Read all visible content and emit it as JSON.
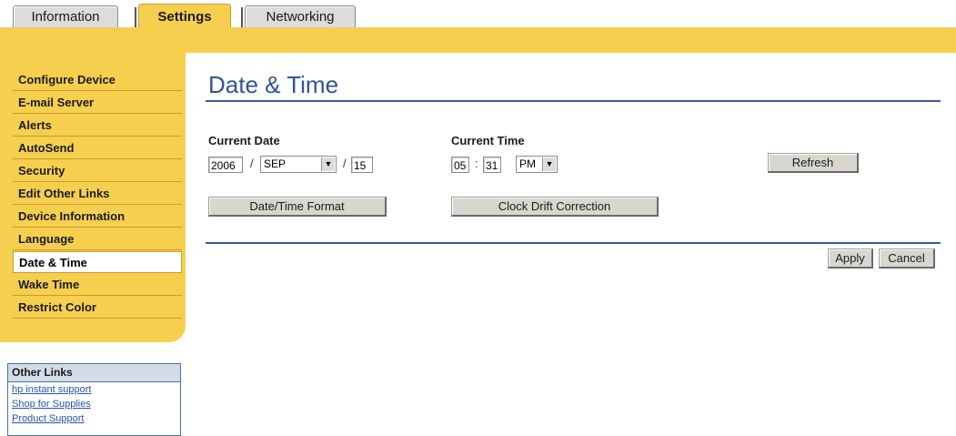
{
  "tabs": [
    {
      "label": "Information"
    },
    {
      "label": "Settings"
    },
    {
      "label": "Networking"
    }
  ],
  "sidebar": {
    "items": [
      {
        "label": "Configure Device"
      },
      {
        "label": "E-mail Server"
      },
      {
        "label": "Alerts"
      },
      {
        "label": "AutoSend"
      },
      {
        "label": "Security"
      },
      {
        "label": "Edit Other Links"
      },
      {
        "label": "Device Information"
      },
      {
        "label": "Language"
      },
      {
        "label": "Date & Time"
      },
      {
        "label": "Wake Time"
      },
      {
        "label": "Restrict Color"
      }
    ],
    "active": "Date & Time"
  },
  "other_links": {
    "title": "Other Links",
    "links": [
      {
        "label": "hp instant support"
      },
      {
        "label": "Shop for Supplies"
      },
      {
        "label": "Product Support"
      }
    ]
  },
  "main": {
    "title": "Date & Time",
    "current_date": {
      "label": "Current Date",
      "year": "2006",
      "month": "SEP",
      "day": "15",
      "sep": "/"
    },
    "current_time": {
      "label": "Current Time",
      "hour": "05",
      "minute": "31",
      "ampm": "PM",
      "sep": ":"
    },
    "buttons": {
      "refresh": "Refresh",
      "date_time_format": "Date/Time Format",
      "clock_drift": "Clock Drift Correction",
      "apply": "Apply",
      "cancel": "Cancel"
    }
  },
  "colors": {
    "accent_yellow": "#f6cf4f",
    "title_blue": "#2f5597",
    "link_blue": "#2a4fb0"
  }
}
